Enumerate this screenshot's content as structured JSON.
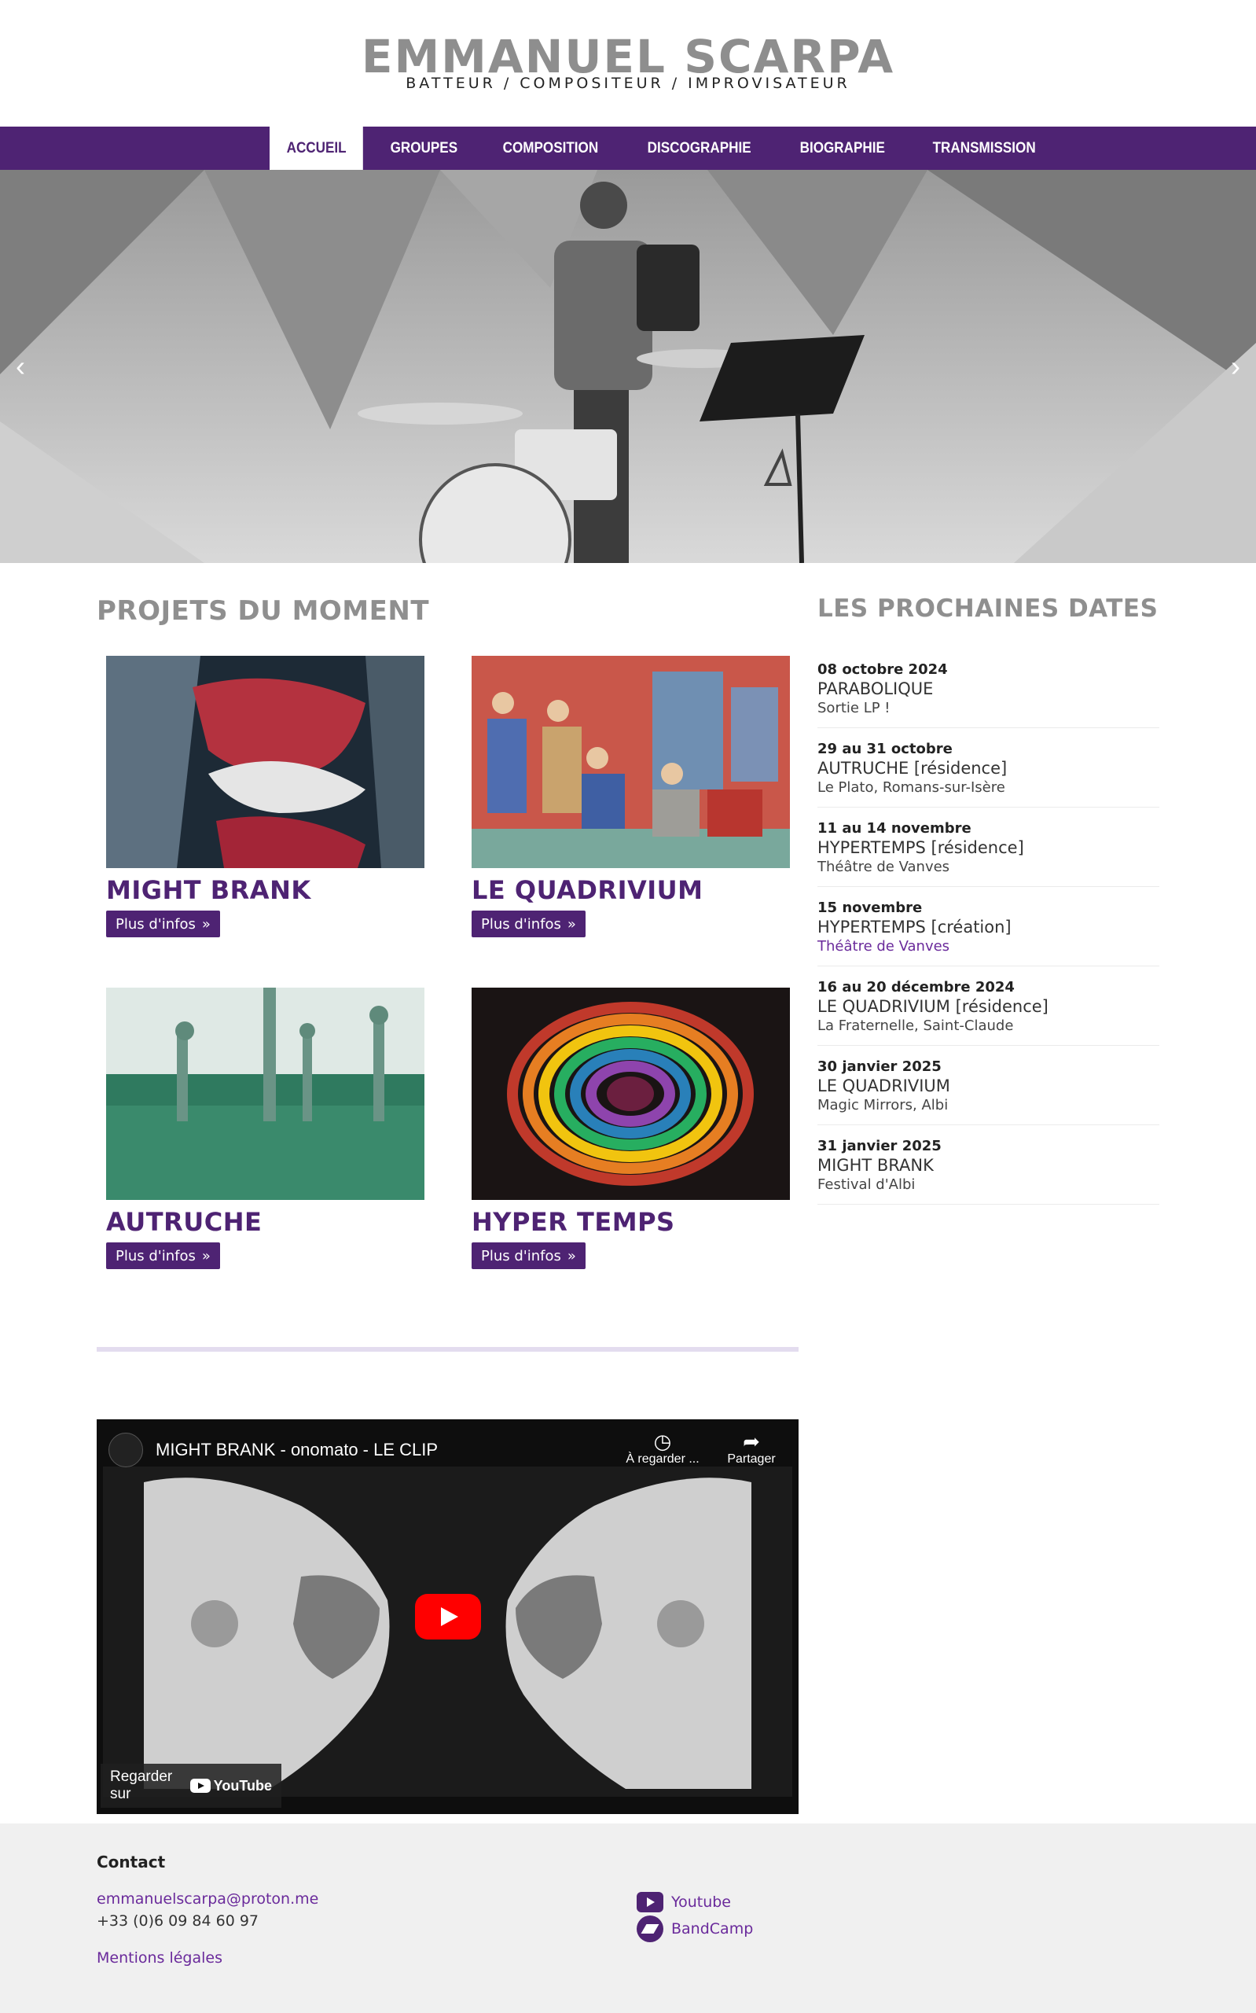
{
  "header": {
    "title": "EMMANUEL SCARPA",
    "subtitle": "BATTEUR / COMPOSITEUR / IMPROVISATEUR"
  },
  "nav": {
    "items": [
      {
        "label": "ACCUEIL",
        "active": true
      },
      {
        "label": "GROUPES",
        "active": false
      },
      {
        "label": "COMPOSITION",
        "active": false
      },
      {
        "label": "DISCOGRAPHIE",
        "active": false
      },
      {
        "label": "BIOGRAPHIE",
        "active": false
      },
      {
        "label": "TRANSMISSION",
        "active": false
      }
    ]
  },
  "hero": {
    "prev_icon": "chevron-left-icon",
    "next_icon": "chevron-right-icon"
  },
  "projects": {
    "title": "PROJETS DU MOMENT",
    "button_label": "Plus d'infos",
    "items": [
      {
        "name": "MIGHT BRANK"
      },
      {
        "name": "LE QUADRIVIUM"
      },
      {
        "name": "AUTRUCHE"
      },
      {
        "name": "HYPER TEMPS"
      }
    ]
  },
  "dates": {
    "title": "LES PROCHAINES DATES",
    "items": [
      {
        "date": "08 octobre 2024",
        "event": "PARABOLIQUE",
        "place": "Sortie LP !",
        "link": false
      },
      {
        "date": "29 au 31 octobre",
        "event": "AUTRUCHE [résidence]",
        "place": "Le Plato, Romans-sur-Isère",
        "link": false
      },
      {
        "date": "11 au 14 novembre",
        "event": "HYPERTEMPS [résidence]",
        "place": "Théâtre de Vanves",
        "link": false
      },
      {
        "date": "15 novembre",
        "event": "HYPERTEMPS [création]",
        "place": "Théâtre de Vanves",
        "link": true
      },
      {
        "date": "16 au 20 décembre 2024",
        "event": "LE QUADRIVIUM [résidence]",
        "place": "La Fraternelle, Saint-Claude",
        "link": false
      },
      {
        "date": "30 janvier 2025",
        "event": "LE QUADRIVIUM",
        "place": "Magic Mirrors, Albi",
        "link": false
      },
      {
        "date": "31 janvier 2025",
        "event": "MIGHT BRANK",
        "place": "Festival d'Albi",
        "link": false
      }
    ]
  },
  "video": {
    "title": "MIGHT BRANK - onomato - LE CLIP",
    "watch_later": "À regarder ...",
    "share": "Partager",
    "watch_on": "Regarder sur",
    "youtube": "YouTube"
  },
  "footer": {
    "contact_label": "Contact",
    "email": "emmanuelscarpa@proton.me",
    "phone": "+33 (0)6 09 84 60 97",
    "legal": "Mentions légales",
    "social": [
      {
        "label": "Youtube",
        "icon": "youtube-icon"
      },
      {
        "label": "BandCamp",
        "icon": "bandcamp-icon"
      }
    ]
  },
  "colors": {
    "brand": "#4e2373",
    "link": "#6a2a9b",
    "title_gray": "#8f8f8f"
  }
}
